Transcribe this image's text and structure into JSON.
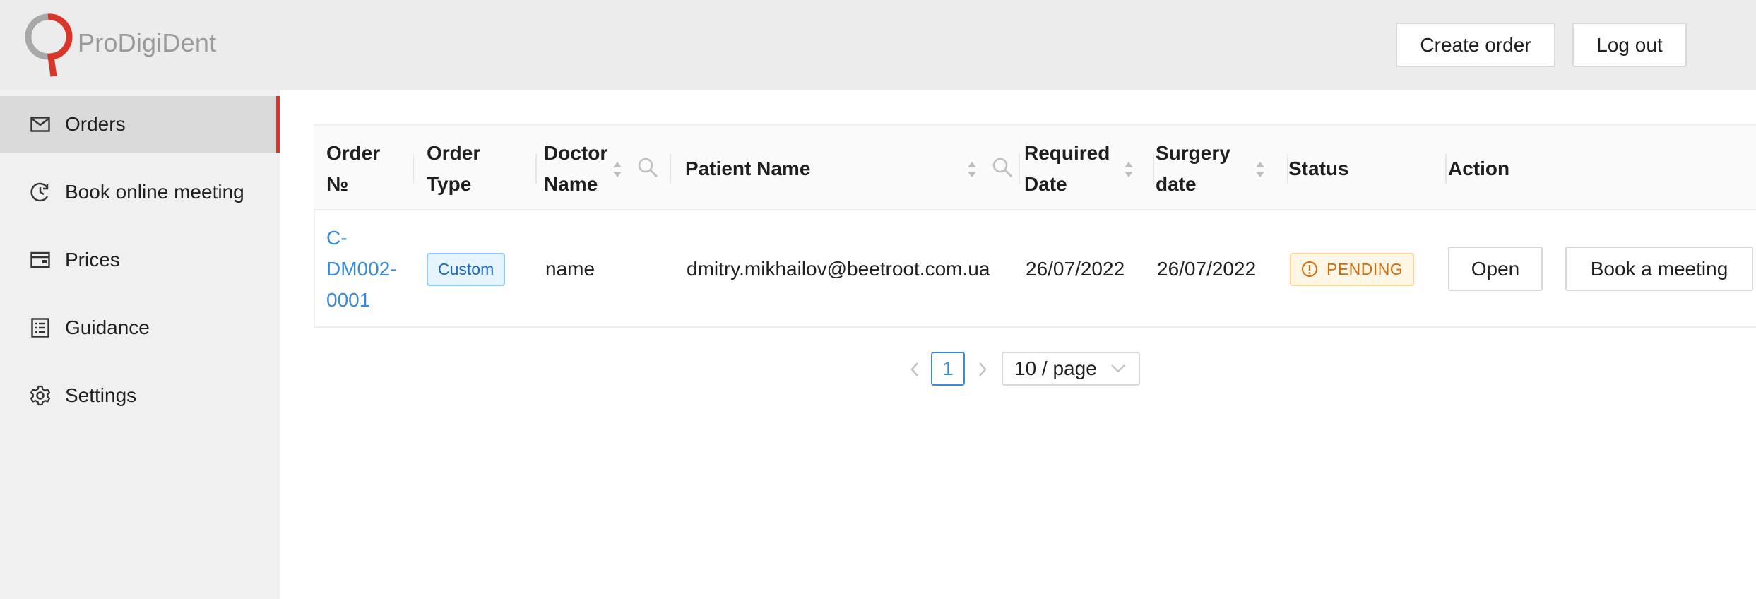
{
  "brand": {
    "name": "ProDigiDent"
  },
  "header": {
    "create_order": "Create order",
    "log_out": "Log out"
  },
  "sidebar": {
    "items": [
      {
        "label": "Orders",
        "icon": "mail-icon",
        "active": true
      },
      {
        "label": "Book online meeting",
        "icon": "clock-icon",
        "active": false
      },
      {
        "label": "Prices",
        "icon": "wallet-icon",
        "active": false
      },
      {
        "label": "Guidance",
        "icon": "list-icon",
        "active": false
      },
      {
        "label": "Settings",
        "icon": "gear-icon",
        "active": false
      }
    ]
  },
  "table": {
    "columns": {
      "order_no": "Order №",
      "order_type": "Order Type",
      "doctor_name": "Doctor Name",
      "patient_name": "Patient Name",
      "required_date": "Required Date",
      "surgery_date": "Surgery date",
      "status": "Status",
      "action": "Action"
    },
    "rows": [
      {
        "order_no_parts": [
          "C-",
          "DM002-",
          "0001"
        ],
        "order_type": "Custom",
        "doctor_name": "name",
        "patient_name": "dmitry.mikhailov@beetroot.com.ua",
        "required_date": "26/07/2022",
        "surgery_date": "26/07/2022",
        "status": "PENDING",
        "actions": {
          "open": "Open",
          "book": "Book a meeting"
        }
      }
    ]
  },
  "pagination": {
    "current_page": "1",
    "page_size": "10 / page"
  },
  "colors": {
    "accent": "#3a8bdb",
    "active_border": "#d9362b",
    "pending": "#d46b08"
  }
}
